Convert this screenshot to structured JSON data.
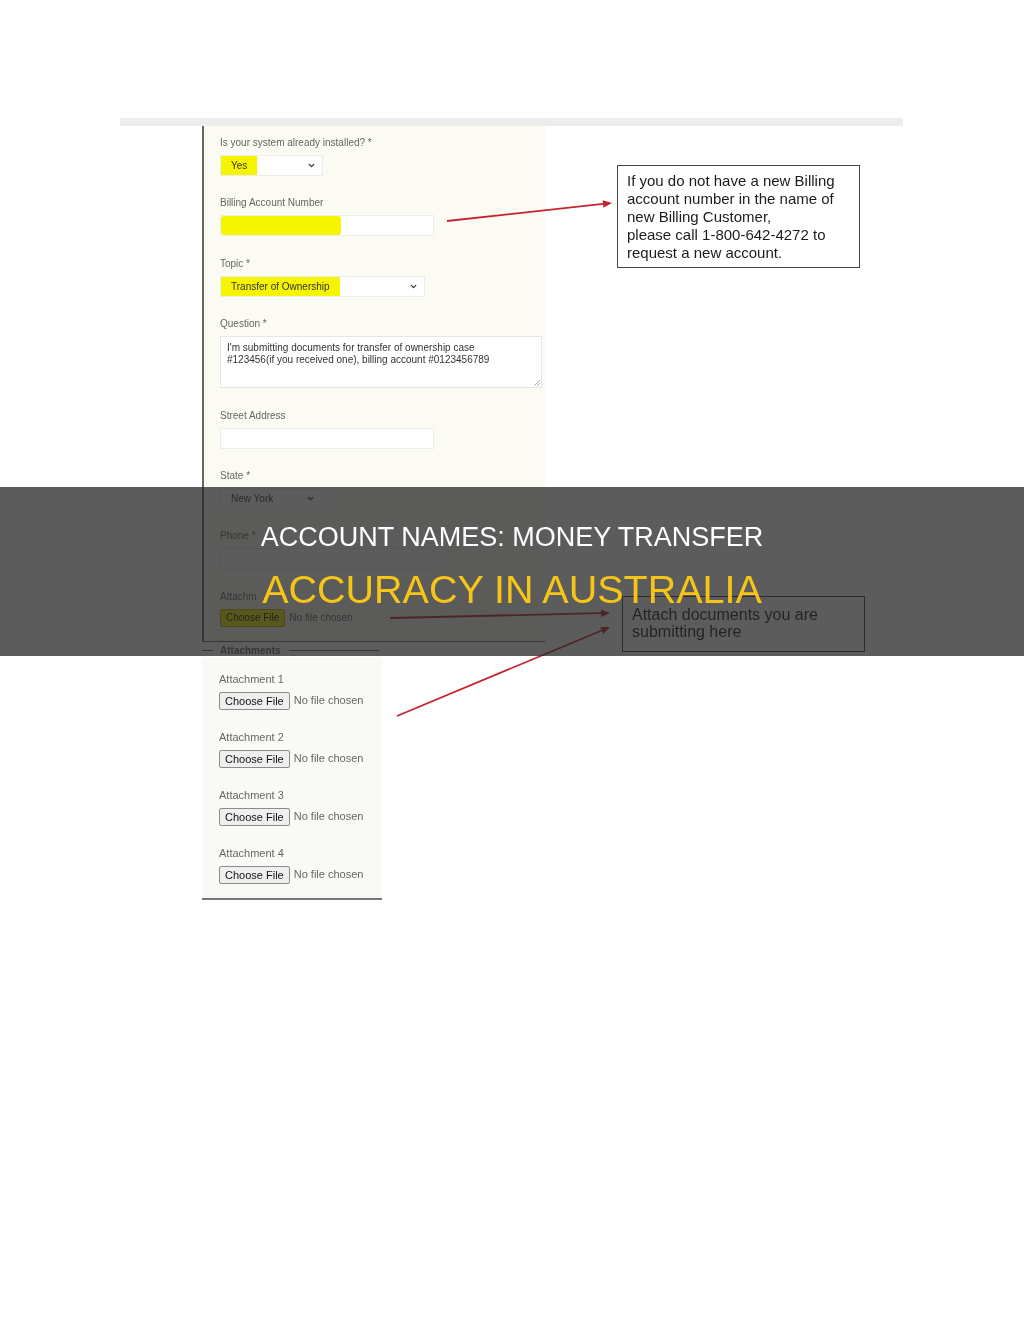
{
  "form": {
    "fields": [
      {
        "kind": "select",
        "label": "Is your system already installed? *",
        "value": "Yes",
        "highlighted": true
      },
      {
        "kind": "text",
        "label": "Billing Account Number",
        "highlighted": true
      },
      {
        "kind": "select",
        "label": "Topic *",
        "value": "Transfer of Ownership",
        "highlighted": true
      },
      {
        "kind": "textarea",
        "label": "Question *",
        "value": "I'm submitting documents for transfer of ownership case #123456(if you received one), billing account #0123456789"
      },
      {
        "kind": "text",
        "label": "Street Address",
        "highlighted": false
      },
      {
        "kind": "select",
        "label": "State *",
        "value": "New York",
        "highlighted": false
      },
      {
        "kind": "text",
        "label": "Phone *",
        "highlighted": false
      },
      {
        "kind": "file",
        "label": "Attachm",
        "button": "Choose File",
        "status": "No file chosen",
        "highlighted": true
      }
    ]
  },
  "callouts": [
    {
      "text": "If you do not have a new Billing account number in the name of new Billing Customer,\nplease call 1-800-642-4272 to request a new account."
    },
    {
      "text": "Attach documents you are submitting here"
    }
  ],
  "attachments": {
    "legend": "Attachments",
    "items": [
      {
        "label": "Attachment 1",
        "button": "Choose File",
        "status": "No file chosen"
      },
      {
        "label": "Attachment 2",
        "button": "Choose File",
        "status": "No file chosen"
      },
      {
        "label": "Attachment 3",
        "button": "Choose File",
        "status": "No file chosen"
      },
      {
        "label": "Attachment 4",
        "button": "Choose File",
        "status": "No file chosen"
      }
    ]
  },
  "banner": {
    "lines": [
      {
        "text": "ACCOUNT NAMES: MONEY TRANSFER",
        "color": "#ffffff"
      },
      {
        "text": "ACCURACY IN AUSTRALIA",
        "color": "#f5c518"
      }
    ]
  }
}
